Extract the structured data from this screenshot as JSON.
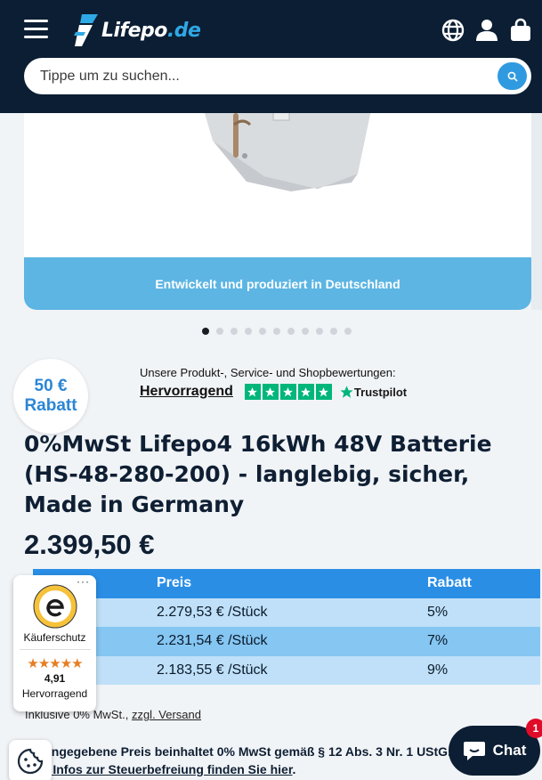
{
  "header": {
    "logo_text_main": "Lifepo",
    "logo_text_tld": ".de",
    "icons": [
      "menu-icon",
      "globe-icon",
      "account-icon",
      "cart-icon"
    ]
  },
  "search": {
    "placeholder": "Tippe um zu suchen...",
    "value": ""
  },
  "hero": {
    "caption": "Entwickelt und produziert in Deutschland",
    "slides_total": 11,
    "active_slide": 1
  },
  "discount_badge": {
    "line1": "50 €",
    "line2": "Rabatt"
  },
  "trustpilot": {
    "heading": "Unsere Produkt-, Service- und Shopbewertungen:",
    "verdict": "Hervorragend",
    "brand": "Trustpilot"
  },
  "product": {
    "title": "0%MwSt Lifepo4 16kWh 48V Batterie (HS-48-280-200) - langlebig, sicher, Made in Germany",
    "price": "2.399,50 €"
  },
  "tier_table": {
    "headers": [
      "",
      "Preis",
      "Rabatt"
    ],
    "rows": [
      [
        "",
        "2.279,53 € /Stück",
        "5%"
      ],
      [
        "",
        "2.231,54 € /Stück",
        "7%"
      ],
      [
        "",
        "2.183,55 € /Stück",
        "9%"
      ]
    ]
  },
  "trusted_shops": {
    "more": "···",
    "label": "Käuferschutz",
    "score": "4,91",
    "verdict": "Hervorragend"
  },
  "tax": {
    "text": "Inklusive 0% MwSt.,",
    "link": "zzgl. Versand"
  },
  "note": {
    "text": "angegebene Preis beinhaltet 0% MwSt gemäß § 12 Abs. 3 Nr. 1 UStG.",
    "link": "r Infos zur Steuerbefreiung finden Sie hier"
  },
  "chat": {
    "label": "Chat",
    "unread": "1"
  },
  "colors": {
    "header_bg": "#0c1e33",
    "accent_blue": "#2a8ee5",
    "caption_blue": "#5cb5e3",
    "trustpilot_green": "#00b67a",
    "badge_red": "#e00b28"
  }
}
